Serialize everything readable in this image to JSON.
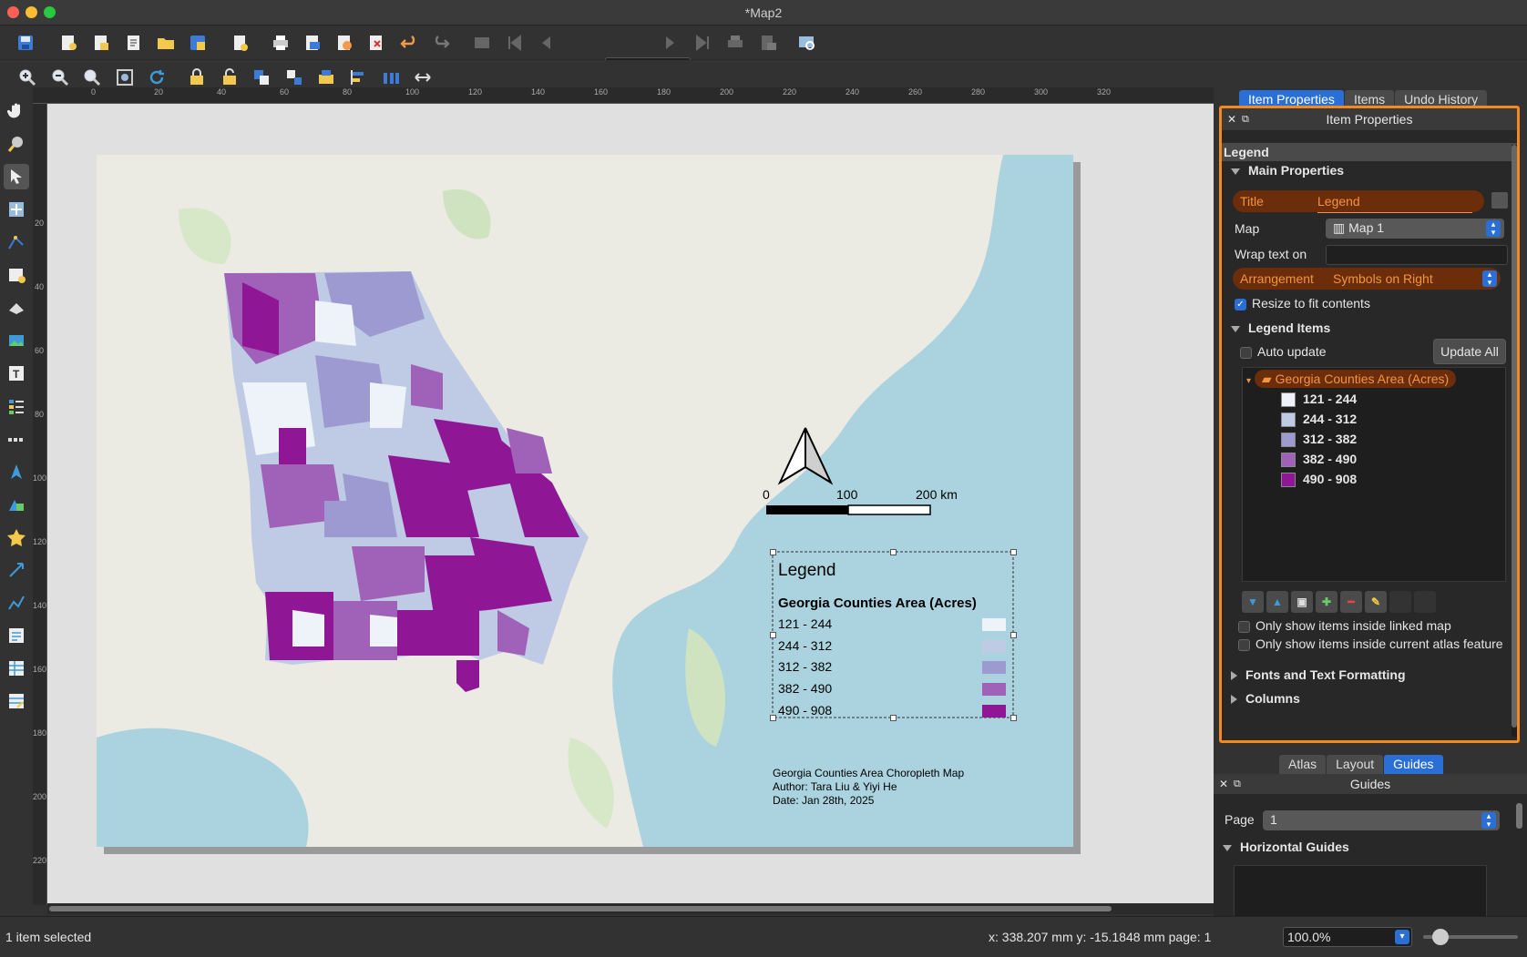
{
  "window": {
    "title": "*Map2"
  },
  "toolbar": {
    "page_number": "1"
  },
  "ruler": {
    "h_ticks": [
      "0",
      "20",
      "40",
      "60",
      "80",
      "100",
      "120",
      "140",
      "160",
      "180",
      "200",
      "220",
      "240",
      "260",
      "280",
      "300",
      "320"
    ],
    "v_ticks": [
      "20",
      "40",
      "60",
      "80",
      "100",
      "120",
      "140",
      "160",
      "180",
      "200",
      "220"
    ]
  },
  "map": {
    "north_arrow": "north-arrow",
    "scalebar": {
      "labels": [
        "0",
        "100",
        "200 km"
      ]
    },
    "legend": {
      "title": "Legend",
      "layer": "Georgia Counties Area (Acres)",
      "classes": [
        {
          "label": "121 - 244",
          "color": "#edf3f8"
        },
        {
          "label": "244 - 312",
          "color": "#bfcbe4"
        },
        {
          "label": "312 - 382",
          "color": "#9c9ad0"
        },
        {
          "label": "382 - 490",
          "color": "#a062b8"
        },
        {
          "label": "490 - 908",
          "color": "#8f1795"
        }
      ]
    },
    "credits": [
      "Georgia Counties Area Choropleth Map",
      "Author: Tara Liu & Yiyi He",
      "Date: Jan 28th, 2025"
    ]
  },
  "dock": {
    "tabs": [
      "Item Properties",
      "Items",
      "Undo History"
    ],
    "active_tab": "Item Properties",
    "panel_title": "Item Properties",
    "item_type": "Legend",
    "main_properties": {
      "section": "Main Properties",
      "title_label": "Title",
      "title_value": "Legend",
      "map_label": "Map",
      "map_value": "Map 1",
      "wrap_label": "Wrap text on",
      "wrap_value": "",
      "arrangement_label": "Arrangement",
      "arrangement_value": "Symbols on Right",
      "resize_label": "Resize to fit contents",
      "resize_checked": true
    },
    "legend_items": {
      "section": "Legend Items",
      "auto_update_label": "Auto update",
      "update_all": "Update All",
      "tree_root": "Georgia Counties Area (Acres)",
      "only_linked_label": "Only show items inside linked map",
      "only_atlas_label": "Only show items inside current atlas feature"
    },
    "collapsed_sections": [
      "Fonts and Text Formatting",
      "Columns"
    ],
    "accent": "#f28a20"
  },
  "bottom_dock": {
    "tabs": [
      "Atlas",
      "Layout",
      "Guides"
    ],
    "active_tab": "Guides",
    "panel_title": "Guides",
    "page_label": "Page",
    "page_value": "1",
    "horizontal_guides": "Horizontal Guides"
  },
  "status": {
    "selection": "1 item selected",
    "coords": "x: 338.207 mm  y: -15.1848 mm  page: 1",
    "zoom": "100.0%"
  }
}
